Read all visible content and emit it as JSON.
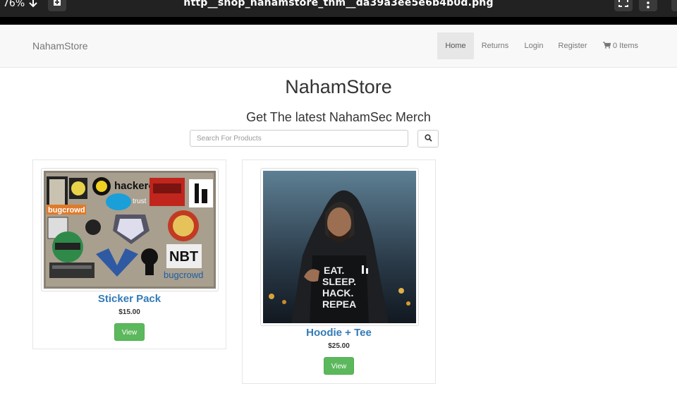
{
  "viewer": {
    "zoom": "76%",
    "filename": "http__shop_nahamstore_thm__da39a3ee5e6b4b0d.png"
  },
  "navbar": {
    "brand": "NahamStore",
    "items": [
      {
        "label": "Home"
      },
      {
        "label": "Returns"
      },
      {
        "label": "Login"
      },
      {
        "label": "Register"
      },
      {
        "label": "0 Items",
        "icon": "cart-icon"
      }
    ],
    "active": "Home"
  },
  "header": {
    "title": "NahamStore",
    "tagline": "Get The latest NahamSec Merch"
  },
  "search": {
    "placeholder": "Search For Products",
    "value": "",
    "icon": "search-icon"
  },
  "products": [
    {
      "name": "Sticker Pack",
      "price": "$15.00",
      "button": "View",
      "image": "laptop-stickers"
    },
    {
      "name": "Hoodie + Tee",
      "price": "$25.00",
      "button": "View",
      "image": "hoodie-person"
    }
  ],
  "colors": {
    "link": "#337ab7",
    "button": "#5cb85c",
    "navbar": "#f8f8f8"
  }
}
